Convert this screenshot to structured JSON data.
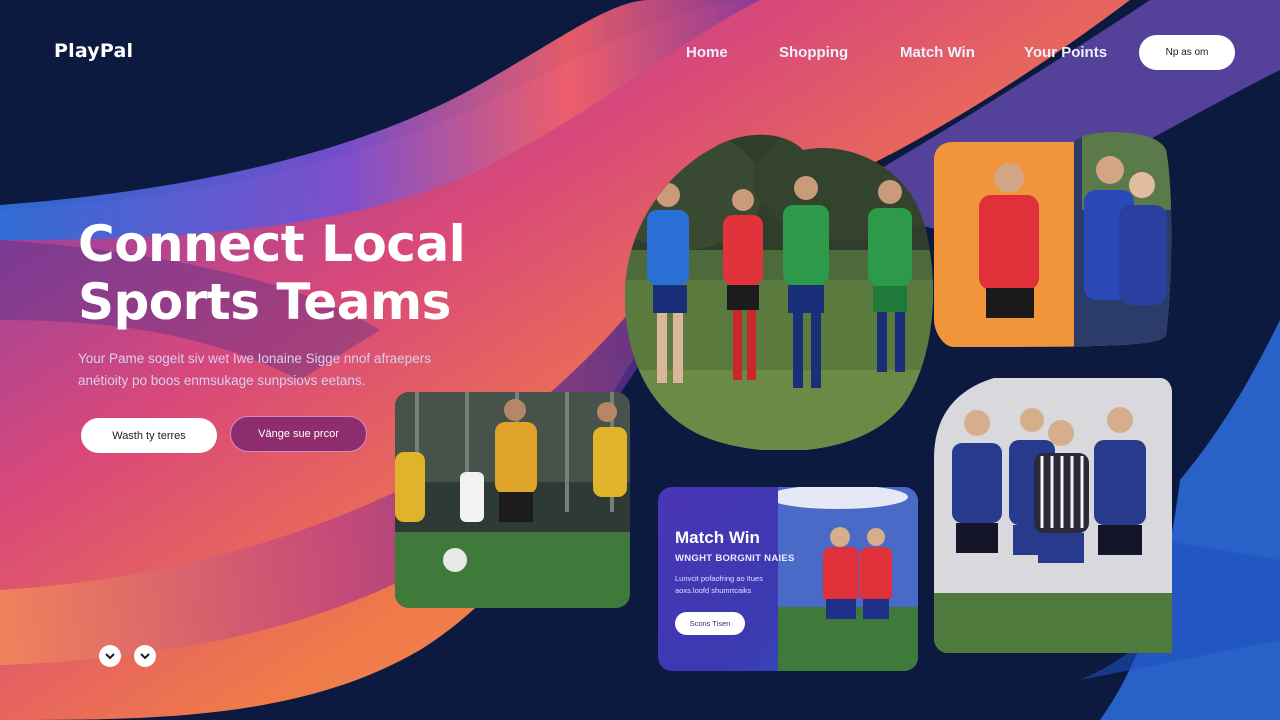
{
  "brand": {
    "name": "PlayPal"
  },
  "nav": {
    "items": [
      {
        "label": "Home"
      },
      {
        "label": "Shopping"
      },
      {
        "label": "Match Win"
      },
      {
        "label": "Your Points"
      }
    ],
    "cta_label": "Np as om"
  },
  "hero": {
    "title_line1": "Connect Local",
    "title_line2": "Sports Teams",
    "subtitle": "Your Pame sogeit siv wet Iwe Ionaine Sigge nnof afraepers anétioity po boos enmsukage sunpsiovs eetans.",
    "primary_button": "Wasth ty terres",
    "secondary_button": "Vänge sue prcor"
  },
  "match_card": {
    "title": "Match Win",
    "subtitle": "WNGHT BORGNIT NAIES",
    "description": "Lunvcit pofaofring ao Itues aoxs.loofd  shumrtcaiks",
    "button": "Scons Tisen"
  },
  "icons": {
    "scroll_left": "chevron-down-icon",
    "scroll_right": "chevron-down-icon"
  },
  "colors": {
    "background": "#0c1a40",
    "accent_magenta": "#8e2d6e",
    "accent_orange": "#f07a4a",
    "accent_blue": "#2d6fd8"
  }
}
